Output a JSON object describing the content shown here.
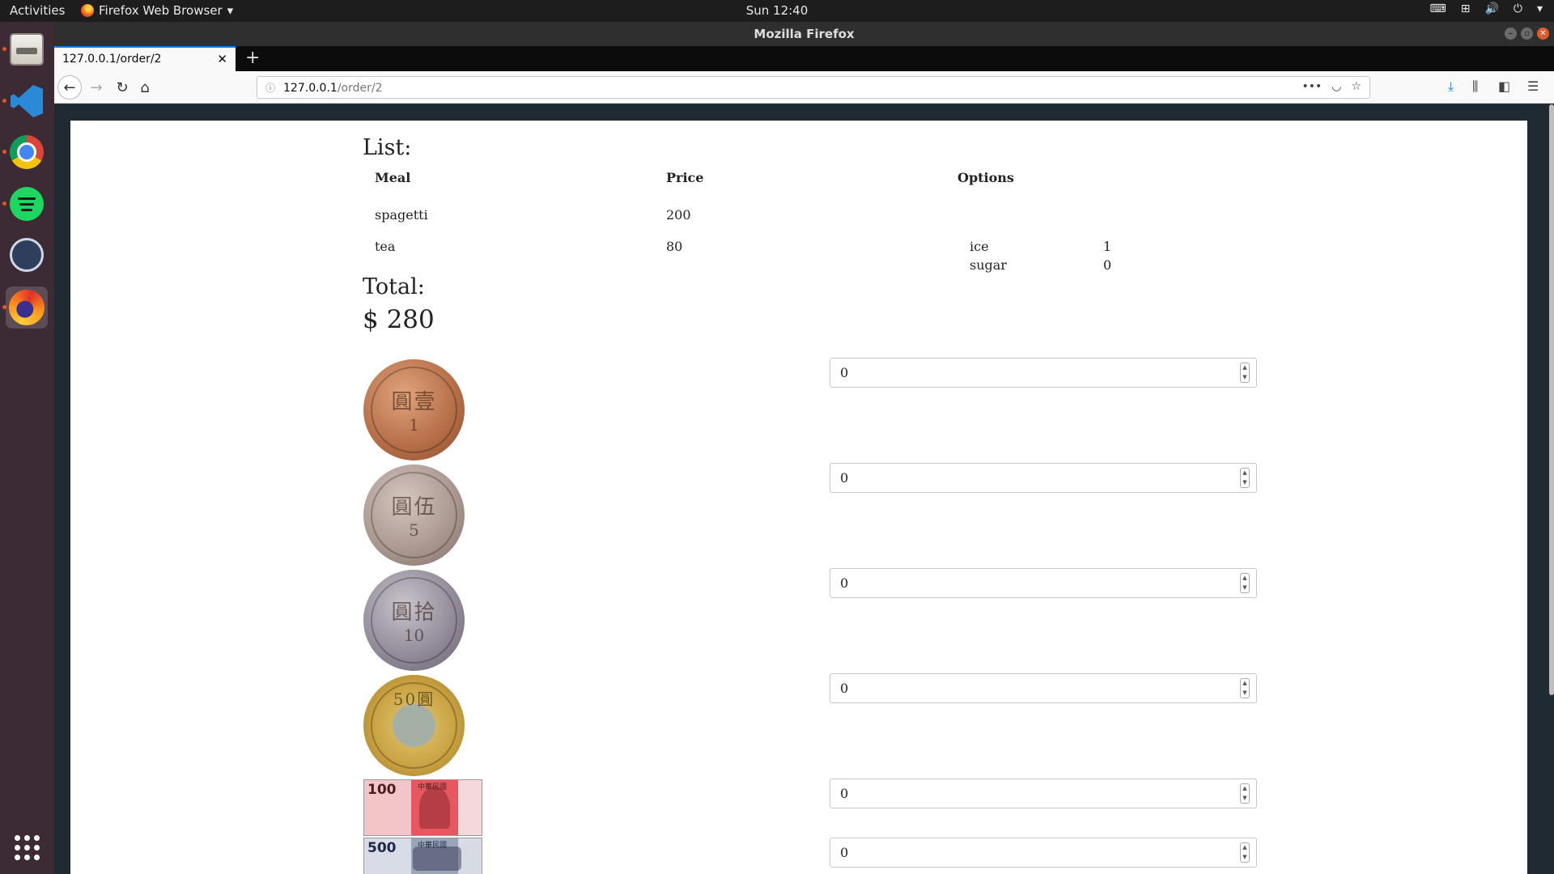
{
  "topbar": {
    "activities": "Activities",
    "app_name": "Firefox Web Browser",
    "clock": "Sun 12:40"
  },
  "dock": {
    "items": [
      "files",
      "vscode",
      "chrome",
      "spotify",
      "ghost-client",
      "firefox",
      "show-applications"
    ]
  },
  "window": {
    "title": "Mozilla Firefox"
  },
  "browser": {
    "tab_title": "127.0.0.1/order/2",
    "url_host": "127.0.0.1",
    "url_path": "/order/2"
  },
  "page": {
    "list_heading": "List:",
    "columns": [
      "Meal",
      "Price",
      "Options"
    ],
    "rows": [
      {
        "meal": "spagetti",
        "price": "200",
        "options": []
      },
      {
        "meal": "tea",
        "price": "80",
        "options": [
          {
            "name": "ice",
            "value": "1"
          },
          {
            "name": "sugar",
            "value": "0"
          }
        ]
      }
    ],
    "total_heading": "Total:",
    "total_value": "$ 280",
    "currency": [
      {
        "type": "coin",
        "icon": "coin-1-icon",
        "face": "圓壹",
        "denom": "1",
        "quantity": "0"
      },
      {
        "type": "coin",
        "icon": "coin-5-icon",
        "face": "圓伍",
        "denom": "5",
        "quantity": "0"
      },
      {
        "type": "coin",
        "icon": "coin-10-icon",
        "face": "圓拾",
        "denom": "10",
        "quantity": "0"
      },
      {
        "type": "coin",
        "icon": "coin-50-icon",
        "face": "50圓",
        "denom": "50",
        "quantity": "0"
      },
      {
        "type": "note",
        "icon": "banknote-100-icon",
        "denom": "100",
        "text": "中華民國",
        "quantity": "0"
      },
      {
        "type": "note",
        "icon": "banknote-500-icon",
        "denom": "500",
        "text": "中華民國",
        "quantity": "0"
      }
    ]
  }
}
